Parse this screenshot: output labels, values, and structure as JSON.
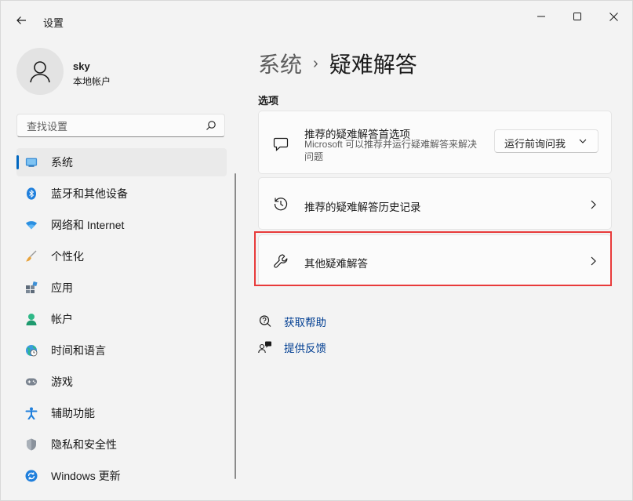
{
  "window": {
    "title": "设置",
    "controls": [
      "minimize",
      "maximize",
      "close"
    ]
  },
  "profile": {
    "name": "sky",
    "account_type": "本地帐户"
  },
  "search": {
    "placeholder": "查找设置"
  },
  "sidebar": {
    "items": [
      {
        "label": "系统",
        "icon": "system-display-icon",
        "active": true
      },
      {
        "label": "蓝牙和其他设备",
        "icon": "bluetooth-icon"
      },
      {
        "label": "网络和 Internet",
        "icon": "wifi-icon"
      },
      {
        "label": "个性化",
        "icon": "paintbrush-icon"
      },
      {
        "label": "应用",
        "icon": "apps-icon"
      },
      {
        "label": "帐户",
        "icon": "person-icon"
      },
      {
        "label": "时间和语言",
        "icon": "globe-clock-icon"
      },
      {
        "label": "游戏",
        "icon": "gamepad-icon"
      },
      {
        "label": "辅助功能",
        "icon": "accessibility-icon"
      },
      {
        "label": "隐私和安全性",
        "icon": "shield-icon"
      },
      {
        "label": "Windows 更新",
        "icon": "update-icon"
      }
    ]
  },
  "breadcrumb": {
    "parent": "系统",
    "separator": "›",
    "current": "疑难解答"
  },
  "main": {
    "section_title": "选项",
    "cards": [
      {
        "title": "推荐的疑难解答首选项",
        "description": "Microsoft 可以推荐并运行疑难解答来解决问题",
        "icon": "chat-bubble-icon",
        "dropdown_value": "运行前询问我"
      },
      {
        "title": "推荐的疑难解答历史记录",
        "icon": "history-icon"
      },
      {
        "title": "其他疑难解答",
        "icon": "wrench-icon",
        "highlighted": true
      }
    ],
    "links": [
      {
        "label": "获取帮助",
        "icon": "help-icon"
      },
      {
        "label": "提供反馈",
        "icon": "feedback-icon"
      }
    ]
  },
  "colors": {
    "accent": "#0067c0",
    "highlight_box": "#e83a3a",
    "link": "#003e92"
  }
}
